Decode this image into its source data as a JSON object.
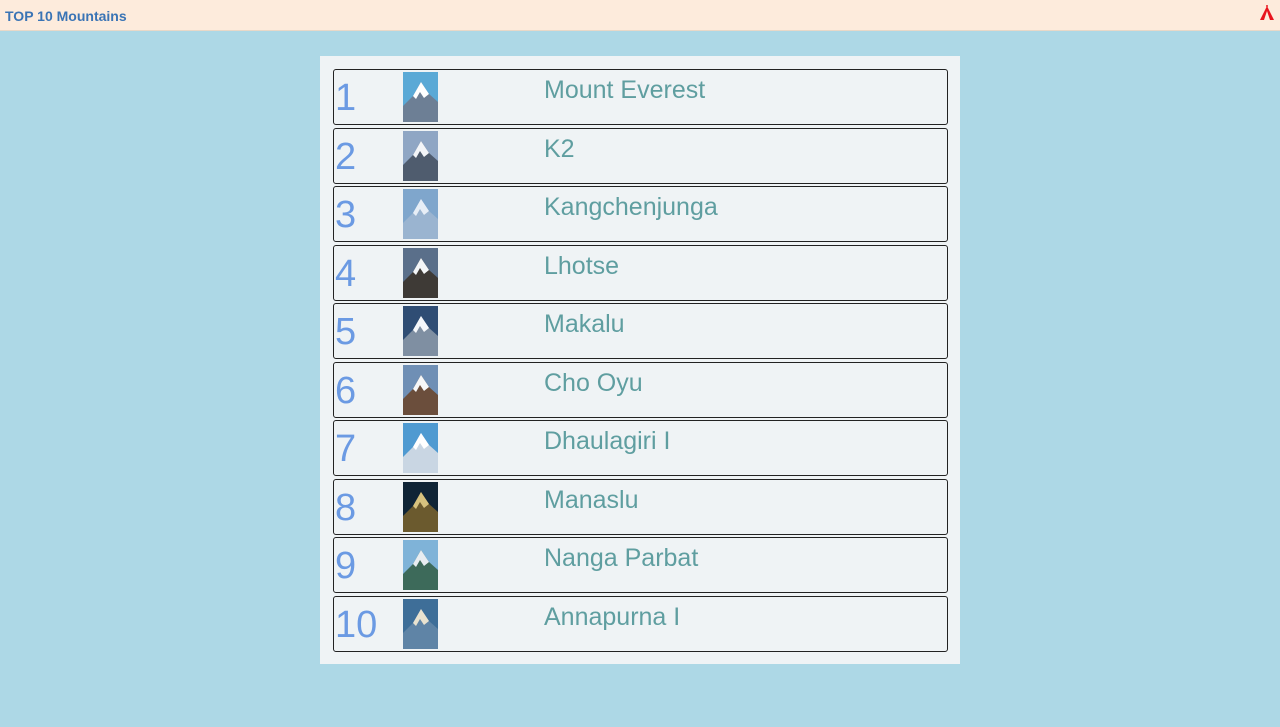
{
  "header": {
    "title": "TOP 10 Mountains",
    "icon": "tent-icon",
    "icon_color": "#e8141e"
  },
  "colors": {
    "background": "#add8e6",
    "header_bg": "#fdebdc",
    "rank_color": "#6b9ae3",
    "name_color": "#5f9ea0"
  },
  "mountains": [
    {
      "rank": "1",
      "name": "Mount Everest",
      "thumb": "mountain-photo-everest"
    },
    {
      "rank": "2",
      "name": "K2",
      "thumb": "mountain-photo-k2"
    },
    {
      "rank": "3",
      "name": "Kangchenjunga",
      "thumb": "mountain-photo-kangchenjunga"
    },
    {
      "rank": "4",
      "name": "Lhotse",
      "thumb": "mountain-photo-lhotse"
    },
    {
      "rank": "5",
      "name": "Makalu",
      "thumb": "mountain-photo-makalu"
    },
    {
      "rank": "6",
      "name": "Cho Oyu",
      "thumb": "mountain-photo-cho-oyu"
    },
    {
      "rank": "7",
      "name": "Dhaulagiri I",
      "thumb": "mountain-photo-dhaulagiri"
    },
    {
      "rank": "8",
      "name": "Manaslu",
      "thumb": "mountain-photo-manaslu"
    },
    {
      "rank": "9",
      "name": "Nanga Parbat",
      "thumb": "mountain-photo-nanga-parbat"
    },
    {
      "rank": "10",
      "name": "Annapurna I",
      "thumb": "mountain-photo-annapurna"
    }
  ]
}
